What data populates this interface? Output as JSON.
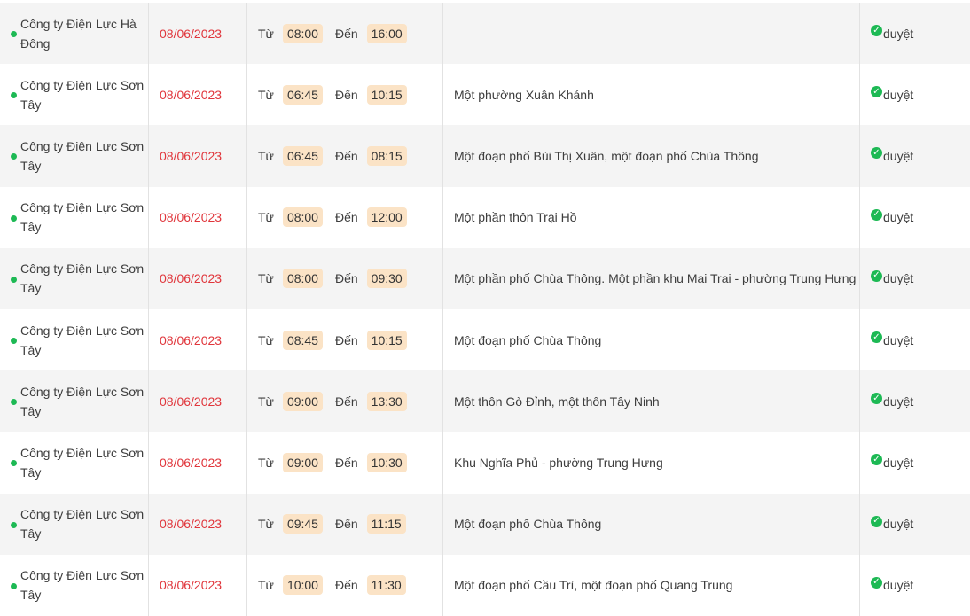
{
  "labels": {
    "from": "Từ",
    "to": "Đến"
  },
  "rows": [
    {
      "unit": "Công ty Điện Lực Hà Đông",
      "date": "08/06/2023",
      "start": "08:00",
      "end": "16:00",
      "area": "",
      "status": "duyệt"
    },
    {
      "unit": "Công ty Điện Lực Sơn Tây",
      "date": "08/06/2023",
      "start": "06:45",
      "end": "10:15",
      "area": "Một phường Xuân Khánh",
      "status": "duyệt"
    },
    {
      "unit": "Công ty Điện Lực Sơn Tây",
      "date": "08/06/2023",
      "start": "06:45",
      "end": "08:15",
      "area": "Một đoạn phố Bùi Thị Xuân, một đoạn phố Chùa Thông",
      "status": "duyệt"
    },
    {
      "unit": "Công ty Điện Lực Sơn Tây",
      "date": "08/06/2023",
      "start": "08:00",
      "end": "12:00",
      "area": "Một phần thôn Trại Hồ",
      "status": "duyệt"
    },
    {
      "unit": "Công ty Điện Lực Sơn Tây",
      "date": "08/06/2023",
      "start": "08:00",
      "end": "09:30",
      "area": "Một phần phố Chùa Thông. Một phần khu Mai Trai - phường Trung Hưng",
      "status": "duyệt"
    },
    {
      "unit": "Công ty Điện Lực Sơn Tây",
      "date": "08/06/2023",
      "start": "08:45",
      "end": "10:15",
      "area": "Một đoạn phố Chùa Thông",
      "status": "duyệt"
    },
    {
      "unit": "Công ty Điện Lực Sơn Tây",
      "date": "08/06/2023",
      "start": "09:00",
      "end": "13:30",
      "area": "Một thôn Gò Đỉnh, một thôn Tây Ninh",
      "status": "duyệt"
    },
    {
      "unit": "Công ty Điện Lực Sơn Tây",
      "date": "08/06/2023",
      "start": "09:00",
      "end": "10:30",
      "area": "Khu Nghĩa Phủ - phường Trung Hưng",
      "status": "duyệt"
    },
    {
      "unit": "Công ty Điện Lực Sơn Tây",
      "date": "08/06/2023",
      "start": "09:45",
      "end": "11:15",
      "area": "Một đoạn phố Chùa Thông",
      "status": "duyệt"
    },
    {
      "unit": "Công ty Điện Lực Sơn Tây",
      "date": "08/06/2023",
      "start": "10:00",
      "end": "11:30",
      "area": "Một đoạn phố Cầu Trì, một đoạn phố Quang Trung",
      "status": "duyệt"
    }
  ],
  "colors": {
    "date": "#e0353b",
    "pill": "#fbe3c6",
    "dot": "#1db954",
    "shade": "#f4f4f4"
  },
  "icons": {
    "unit_marker": "status-dot-icon",
    "approved": "check-circle-icon"
  }
}
